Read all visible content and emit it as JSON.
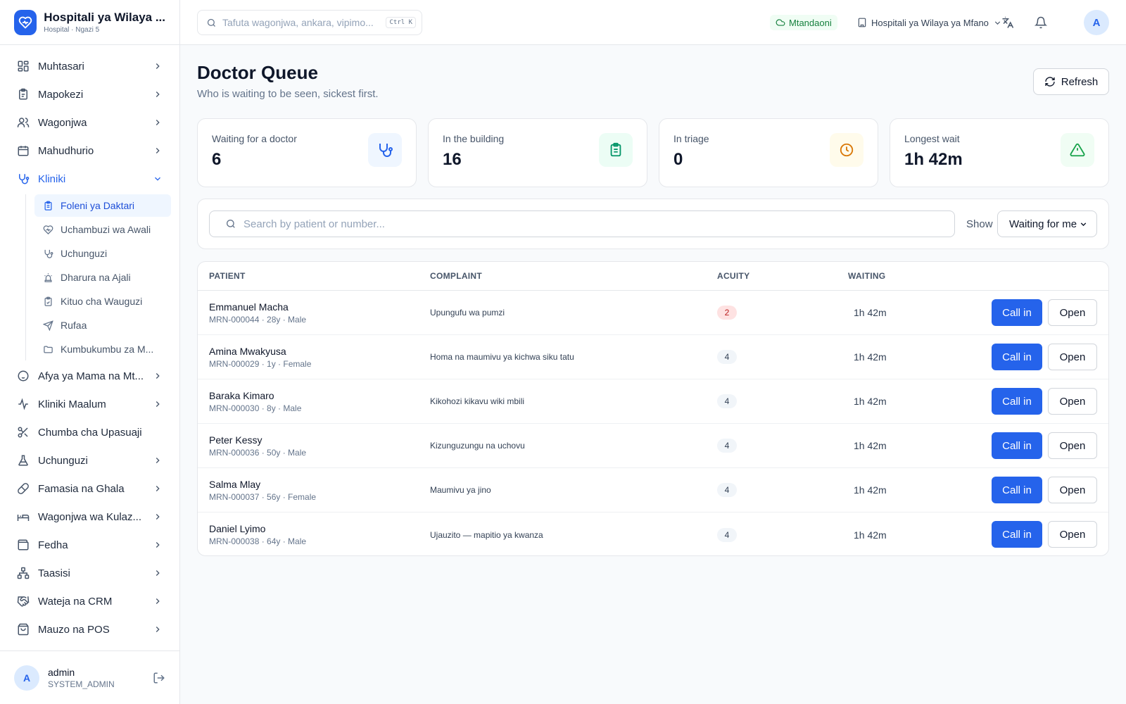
{
  "brand": {
    "title": "Hospitali ya Wilaya ...",
    "subtitle": "Hospital · Ngazi 5"
  },
  "sidebar": {
    "items": [
      {
        "label": "Muhtasari",
        "icon": "grid-icon"
      },
      {
        "label": "Mapokezi",
        "icon": "clipboard-icon"
      },
      {
        "label": "Wagonjwa",
        "icon": "users-icon"
      },
      {
        "label": "Mahudhurio",
        "icon": "calendar-icon"
      },
      {
        "label": "Kliniki",
        "icon": "stethoscope-icon"
      },
      {
        "label": "Afya ya Mama na Mt...",
        "icon": "baby-icon"
      },
      {
        "label": "Kliniki Maalum",
        "icon": "activity-icon"
      },
      {
        "label": "Chumba cha Upasuaji",
        "icon": "scissors-icon"
      },
      {
        "label": "Uchunguzi",
        "icon": "flask-icon"
      },
      {
        "label": "Famasia na Ghala",
        "icon": "pill-icon"
      },
      {
        "label": "Wagonjwa wa Kulaz...",
        "icon": "bed-icon"
      },
      {
        "label": "Fedha",
        "icon": "wallet-icon"
      },
      {
        "label": "Taasisi",
        "icon": "org-icon"
      },
      {
        "label": "Wateja na CRM",
        "icon": "handshake-icon"
      },
      {
        "label": "Mauzo na POS",
        "icon": "shopping-bag-icon"
      }
    ],
    "subitems": [
      {
        "label": "Foleni ya Daktari",
        "icon": "clipboard-list-icon"
      },
      {
        "label": "Uchambuzi wa Awali",
        "icon": "heart-pulse-icon"
      },
      {
        "label": "Uchunguzi",
        "icon": "stethoscope-icon"
      },
      {
        "label": "Dharura na Ajali",
        "icon": "siren-icon"
      },
      {
        "label": "Kituo cha Wauguzi",
        "icon": "clipboard-check-icon"
      },
      {
        "label": "Rufaa",
        "icon": "send-icon"
      },
      {
        "label": "Kumbukumbu za M...",
        "icon": "folder-icon"
      }
    ]
  },
  "user": {
    "initial": "A",
    "name": "admin",
    "role": "SYSTEM_ADMIN"
  },
  "topbar": {
    "search_placeholder": "Tafuta wagonjwa, ankara, vipimo...",
    "shortcut": "Ctrl K",
    "status": "Mtandaoni",
    "facility": "Hospitali ya Wilaya ya Mfano",
    "avatar_initial": "A"
  },
  "page": {
    "title": "Doctor Queue",
    "subtitle": "Who is waiting to be seen, sickest first.",
    "refresh_label": "Refresh"
  },
  "stats": [
    {
      "label": "Waiting for a doctor",
      "value": "6",
      "icon": "stethoscope-icon",
      "color": "#2563eb",
      "bg": "#eff6ff"
    },
    {
      "label": "In the building",
      "value": "16",
      "icon": "clipboard-list-icon",
      "color": "#059669",
      "bg": "#ecfdf5"
    },
    {
      "label": "In triage",
      "value": "0",
      "icon": "clock-icon",
      "color": "#d97706",
      "bg": "#fffbeb"
    },
    {
      "label": "Longest wait",
      "value": "1h 42m",
      "icon": "alert-triangle-icon",
      "color": "#16a34a",
      "bg": "#f0fdf4"
    }
  ],
  "filter": {
    "search_placeholder": "Search by patient or number...",
    "show_label": "Show",
    "show_value": "Waiting for me"
  },
  "table": {
    "headers": {
      "patient": "PATIENT",
      "complaint": "COMPLAINT",
      "acuity": "ACUITY",
      "waiting": "WAITING"
    },
    "call_label": "Call in",
    "open_label": "Open",
    "rows": [
      {
        "name": "Emmanuel Macha",
        "meta": "MRN-000044 · 28y · Male",
        "complaint": "Upungufu wa pumzi",
        "acuity": "2",
        "waiting": "1h 42m"
      },
      {
        "name": "Amina Mwakyusa",
        "meta": "MRN-000029 · 1y · Female",
        "complaint": "Homa na maumivu ya kichwa siku tatu",
        "acuity": "4",
        "waiting": "1h 42m"
      },
      {
        "name": "Baraka Kimaro",
        "meta": "MRN-000030 · 8y · Male",
        "complaint": "Kikohozi kikavu wiki mbili",
        "acuity": "4",
        "waiting": "1h 42m"
      },
      {
        "name": "Peter Kessy",
        "meta": "MRN-000036 · 50y · Male",
        "complaint": "Kizunguzungu na uchovu",
        "acuity": "4",
        "waiting": "1h 42m"
      },
      {
        "name": "Salma Mlay",
        "meta": "MRN-000037 · 56y · Female",
        "complaint": "Maumivu ya jino",
        "acuity": "4",
        "waiting": "1h 42m"
      },
      {
        "name": "Daniel Lyimo",
        "meta": "MRN-000038 · 64y · Male",
        "complaint": "Ujauzito — mapitio ya kwanza",
        "acuity": "4",
        "waiting": "1h 42m"
      }
    ]
  }
}
